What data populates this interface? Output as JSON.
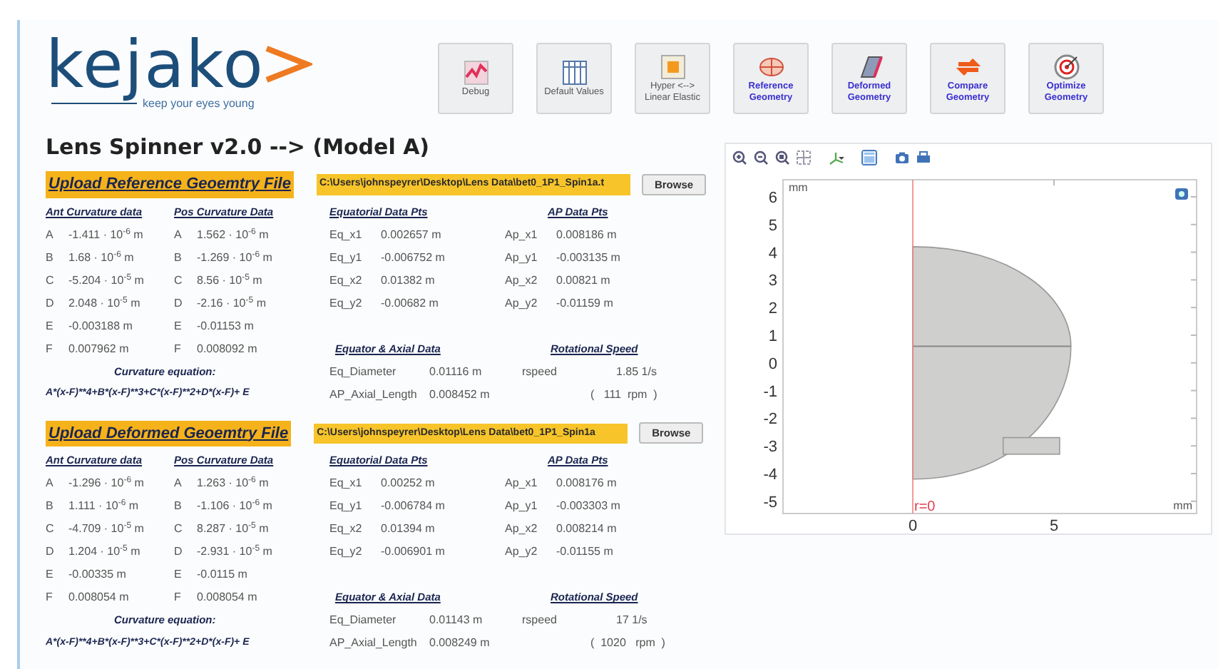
{
  "logo": {
    "name": "kejako",
    "tagline": "keep your eyes young"
  },
  "toolbar": [
    {
      "label": "Debug",
      "kind": "chart",
      "emphasized": false
    },
    {
      "label": "Default Values",
      "kind": "table",
      "emphasized": false
    },
    {
      "label": "Hyper <-->\nLinear Elastic",
      "kind": "cells",
      "emphasized": false
    },
    {
      "label": "Reference\nGeometry",
      "kind": "sphere",
      "emphasized": true
    },
    {
      "label": "Deformed\nGeometry",
      "kind": "slab",
      "emphasized": true
    },
    {
      "label": "Compare\nGeometry",
      "kind": "compare",
      "emphasized": true
    },
    {
      "label": "Optimize\nGeometry",
      "kind": "target",
      "emphasized": true
    }
  ],
  "title": "Lens Spinner v2.0 --> (Model A)",
  "sections": [
    {
      "upload_label": "Upload Reference Geoemtry File",
      "file_path": "C:\\Users\\johnspeyrer\\Desktop\\Lens Data\\bet0_1P1_Spin1a.t",
      "browse": "Browse",
      "ant": {
        "heading": "Ant Curvature data",
        "rows": [
          {
            "label": "A",
            "value": "-1.411 · 10$^{-6}$ m"
          },
          {
            "label": "B",
            "value": "1.68 · 10$^{-6}$ m"
          },
          {
            "label": "C",
            "value": "-5.204 · 10$^{-5}$ m"
          },
          {
            "label": "D",
            "value": "2.048 · 10$^{-5}$ m"
          },
          {
            "label": "E",
            "value": "-0.003188 m"
          },
          {
            "label": "F",
            "value": "0.007962 m"
          }
        ]
      },
      "pos": {
        "heading": "Pos Curvature Data",
        "rows": [
          {
            "label": "A",
            "value": "1.562 · 10$^{-6}$ m"
          },
          {
            "label": "B",
            "value": "-1.269 · 10$^{-6}$ m"
          },
          {
            "label": "C",
            "value": "8.56 · 10$^{-5}$ m"
          },
          {
            "label": "D",
            "value": "-2.16 · 10$^{-5}$ m"
          },
          {
            "label": "E",
            "value": "-0.01153 m"
          },
          {
            "label": "F",
            "value": "0.008092 m"
          }
        ]
      },
      "equatorial": {
        "heading": "Equatorial Data Pts",
        "rows": [
          {
            "label": "Eq_x1",
            "value": "0.002657 m"
          },
          {
            "label": "Eq_y1",
            "value": "-0.006752 m"
          },
          {
            "label": "Eq_x2",
            "value": "0.01382 m"
          },
          {
            "label": "Eq_y2",
            "value": "-0.00682 m"
          }
        ]
      },
      "ap": {
        "heading": "AP Data Pts",
        "rows": [
          {
            "label": "Ap_x1",
            "value": "0.008186 m"
          },
          {
            "label": "Ap_y1",
            "value": "-0.003135 m"
          },
          {
            "label": "Ap_x2",
            "value": "0.00821 m"
          },
          {
            "label": "Ap_y2",
            "value": "-0.01159 m"
          }
        ]
      },
      "curvature_equation": {
        "heading": "Curvature equation:",
        "formula": "A*(x-F)**4+B*(x-F)**3+C*(x-F)**2+D*(x-F)+ E"
      },
      "equator_axial": {
        "heading": "Equator & Axial Data",
        "rows": [
          {
            "label": "Eq_Diameter",
            "value": "0.01116 m"
          },
          {
            "label": "AP_Axial_Length",
            "value": "0.008452 m"
          }
        ]
      },
      "rotational_speed": {
        "heading": "Rotational Speed",
        "label": "rspeed",
        "value": "1.85 1/s",
        "rpm": "(   111  rpm  )"
      }
    },
    {
      "upload_label": "Upload Deformed Geoemtry File",
      "file_path": "C:\\Users\\johnspeyrer\\Desktop\\Lens Data\\bet0_1P1_Spin1a",
      "browse": "Browse",
      "ant": {
        "heading": "Ant Curvature data",
        "rows": [
          {
            "label": "A",
            "value": "-1.296 · 10$^{-6}$ m"
          },
          {
            "label": "B",
            "value": "1.111 · 10$^{-6}$ m"
          },
          {
            "label": "C",
            "value": "-4.709 · 10$^{-5}$ m"
          },
          {
            "label": "D",
            "value": "1.204 · 10$^{-5}$ m"
          },
          {
            "label": "E",
            "value": "-0.00335 m"
          },
          {
            "label": "F",
            "value": "0.008054 m"
          }
        ]
      },
      "pos": {
        "heading": "Pos Curvature Data",
        "rows": [
          {
            "label": "A",
            "value": "1.263 · 10$^{-6}$ m"
          },
          {
            "label": "B",
            "value": "-1.106 · 10$^{-6}$ m"
          },
          {
            "label": "C",
            "value": "8.287 · 10$^{-5}$ m"
          },
          {
            "label": "D",
            "value": "-2.931 · 10$^{-5}$ m"
          },
          {
            "label": "E",
            "value": "-0.0115 m"
          },
          {
            "label": "F",
            "value": "0.008054 m"
          }
        ]
      },
      "equatorial": {
        "heading": "Equatorial Data Pts",
        "rows": [
          {
            "label": "Eq_x1",
            "value": "0.00252 m"
          },
          {
            "label": "Eq_y1",
            "value": "-0.006784 m"
          },
          {
            "label": "Eq_x2",
            "value": "0.01394 m"
          },
          {
            "label": "Eq_y2",
            "value": "-0.006901 m"
          }
        ]
      },
      "ap": {
        "heading": "AP Data Pts",
        "rows": [
          {
            "label": "Ap_x1",
            "value": "0.008176 m"
          },
          {
            "label": "Ap_y1",
            "value": "-0.003303 m"
          },
          {
            "label": "Ap_x2",
            "value": "0.008214 m"
          },
          {
            "label": "Ap_y2",
            "value": "-0.01155 m"
          }
        ]
      },
      "curvature_equation": {
        "heading": "Curvature equation:",
        "formula": "A*(x-F)**4+B*(x-F)**3+C*(x-F)**2+D*(x-F)+ E"
      },
      "equator_axial": {
        "heading": "Equator & Axial Data",
        "rows": [
          {
            "label": "Eq_Diameter",
            "value": "0.01143 m"
          },
          {
            "label": "AP_Axial_Length",
            "value": "0.008249 m"
          }
        ]
      },
      "rotational_speed": {
        "heading": "Rotational Speed",
        "label": "rspeed",
        "value": "17 1/s",
        "rpm": "(  1020   rpm  )"
      }
    }
  ],
  "plot": {
    "toolbar": [
      {
        "kind": "zoom-in",
        "selected": false
      },
      {
        "kind": "zoom-out",
        "selected": false
      },
      {
        "kind": "zoom-box",
        "selected": false
      },
      {
        "kind": "zoom-extents",
        "selected": false
      },
      {
        "kind": "axes",
        "selected": false
      },
      {
        "kind": "grid",
        "selected": true
      },
      {
        "kind": "camera",
        "selected": false
      },
      {
        "kind": "print",
        "selected": false
      }
    ],
    "y_unit": "mm",
    "x_unit": "mm",
    "axis_label": "r=0",
    "y_ticks": [
      "6",
      "5",
      "4",
      "3",
      "2",
      "1",
      "0",
      "-1",
      "-2",
      "-3",
      "-4",
      "-5"
    ],
    "x_ticks": [
      "0",
      "5"
    ]
  }
}
